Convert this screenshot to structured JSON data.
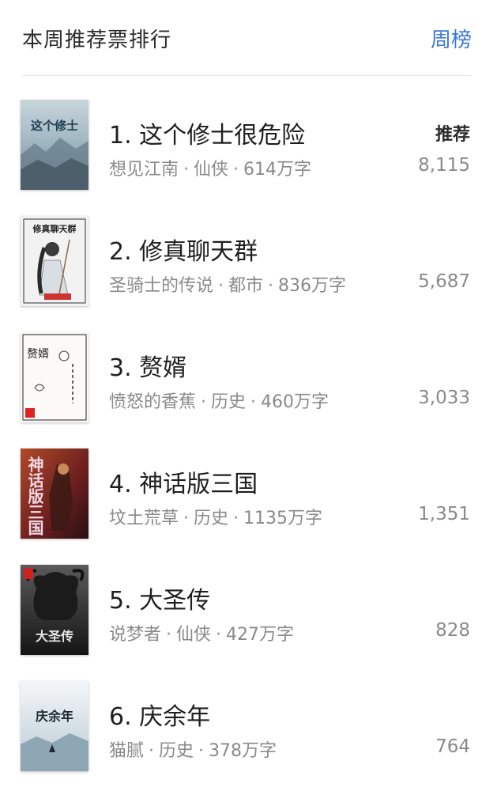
{
  "header": {
    "title": "本周推荐票排行",
    "link_label": "周榜"
  },
  "list": {
    "items": [
      {
        "rank_title": "1. 这个修士很危险",
        "author": "想见江南",
        "genre": "仙侠",
        "words": "614万字",
        "tag": "推荐",
        "votes": "8,115",
        "cover_icon": "book-cover-misty-mountains",
        "cover_text": "这个修士",
        "cover_color": "#9fb4c0"
      },
      {
        "rank_title": "2. 修真聊天群",
        "author": "圣骑士的传说",
        "genre": "都市",
        "words": "836万字",
        "tag": "",
        "votes": "5,687",
        "cover_icon": "book-cover-swordsman",
        "cover_text": "修真聊天群",
        "cover_color": "#f2f2f2"
      },
      {
        "rank_title": "3. 赘婿",
        "author": "愤怒的香蕉",
        "genre": "历史",
        "words": "460万字",
        "tag": "",
        "votes": "3,033",
        "cover_icon": "book-cover-calligraphy",
        "cover_text": "赘婿",
        "cover_color": "#fbfaf6"
      },
      {
        "rank_title": "4. 神话版三国",
        "author": "坟土荒草",
        "genre": "历史",
        "words": "1135万字",
        "tag": "",
        "votes": "1,351",
        "cover_icon": "book-cover-warrior",
        "cover_text": "神话版三国",
        "cover_color": "#7a2a2a"
      },
      {
        "rank_title": "5. 大圣传",
        "author": "说梦者",
        "genre": "仙侠",
        "words": "427万字",
        "tag": "",
        "votes": "828",
        "cover_icon": "book-cover-dark-beast",
        "cover_text": "大圣传",
        "cover_color": "#2a2a2a"
      },
      {
        "rank_title": "6. 庆余年",
        "author": "猫腻",
        "genre": "历史",
        "words": "378万字",
        "tag": "",
        "votes": "764",
        "cover_icon": "book-cover-snow",
        "cover_text": "庆余年",
        "cover_color": "#dfe8ee"
      }
    ],
    "separator": "·"
  }
}
